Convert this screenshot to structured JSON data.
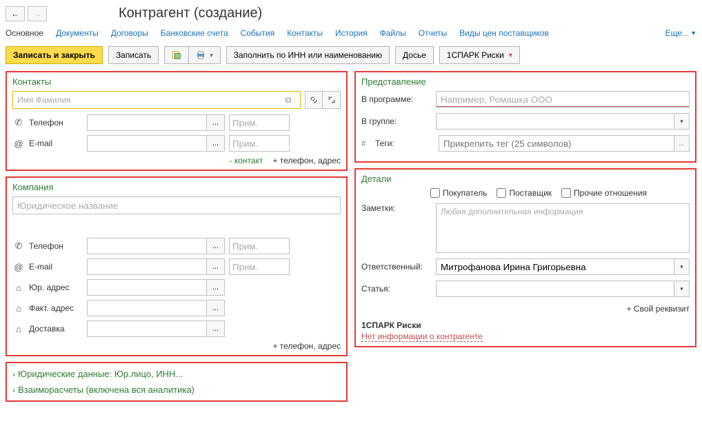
{
  "header": {
    "title": "Контрагент (создание)"
  },
  "tabs": {
    "main": "Основное",
    "docs": "Документы",
    "contracts": "Договоры",
    "bank": "Банковские счета",
    "events": "События",
    "contacts": "Контакты",
    "history": "История",
    "files": "Файлы",
    "reports": "Отчеты",
    "prices": "Виды цен поставщиков",
    "more": "Еще..."
  },
  "toolbar": {
    "save_close": "Записать и закрыть",
    "save": "Записать",
    "fill_by_inn": "Заполнить по ИНН или наименованию",
    "dossier": "Досье",
    "spark": "1СПАРК Риски"
  },
  "contacts": {
    "title": "Контакты",
    "name_placeholder": "Имя Фамилия",
    "phone_label": "Телефон",
    "email_label": "E-mail",
    "note_placeholder": "Прим.",
    "minus_contact": "- контакт",
    "add_phone_addr": "+ телефон, адрес"
  },
  "company": {
    "title": "Компания",
    "name_placeholder": "Юридическое название",
    "phone_label": "Телефон",
    "email_label": "E-mail",
    "legal_addr": "Юр. адрес",
    "fact_addr": "Факт. адрес",
    "delivery": "Доставка",
    "note_placeholder": "Прим.",
    "add_phone_addr": "+ телефон, адрес"
  },
  "expanders": {
    "legal": "Юридические данные: Юр.лицо, ИНН...",
    "settlements": "Взаиморасчеты (включена вся аналитика)"
  },
  "representation": {
    "title": "Представление",
    "in_program": "В программе:",
    "in_program_ph": "Например, Ромашка ООО",
    "in_group": "В группе:",
    "tags": "Теги:",
    "tags_ph": "Прикрепить тег (25 символов)"
  },
  "details": {
    "title": "Детали",
    "buyer": "Покупатель",
    "supplier": "Поставщик",
    "other": "Прочие отношения",
    "notes_label": "Заметки:",
    "notes_ph": "Любая дополнительная информация",
    "responsible": "Ответственный:",
    "responsible_val": "Митрофанова Ирина Григорьевна",
    "article": "Статья:",
    "add_requisite": "+ Свой реквизит",
    "spark_title": "1СПАРК Риски",
    "spark_info": "Нет информации о контрагенте"
  }
}
